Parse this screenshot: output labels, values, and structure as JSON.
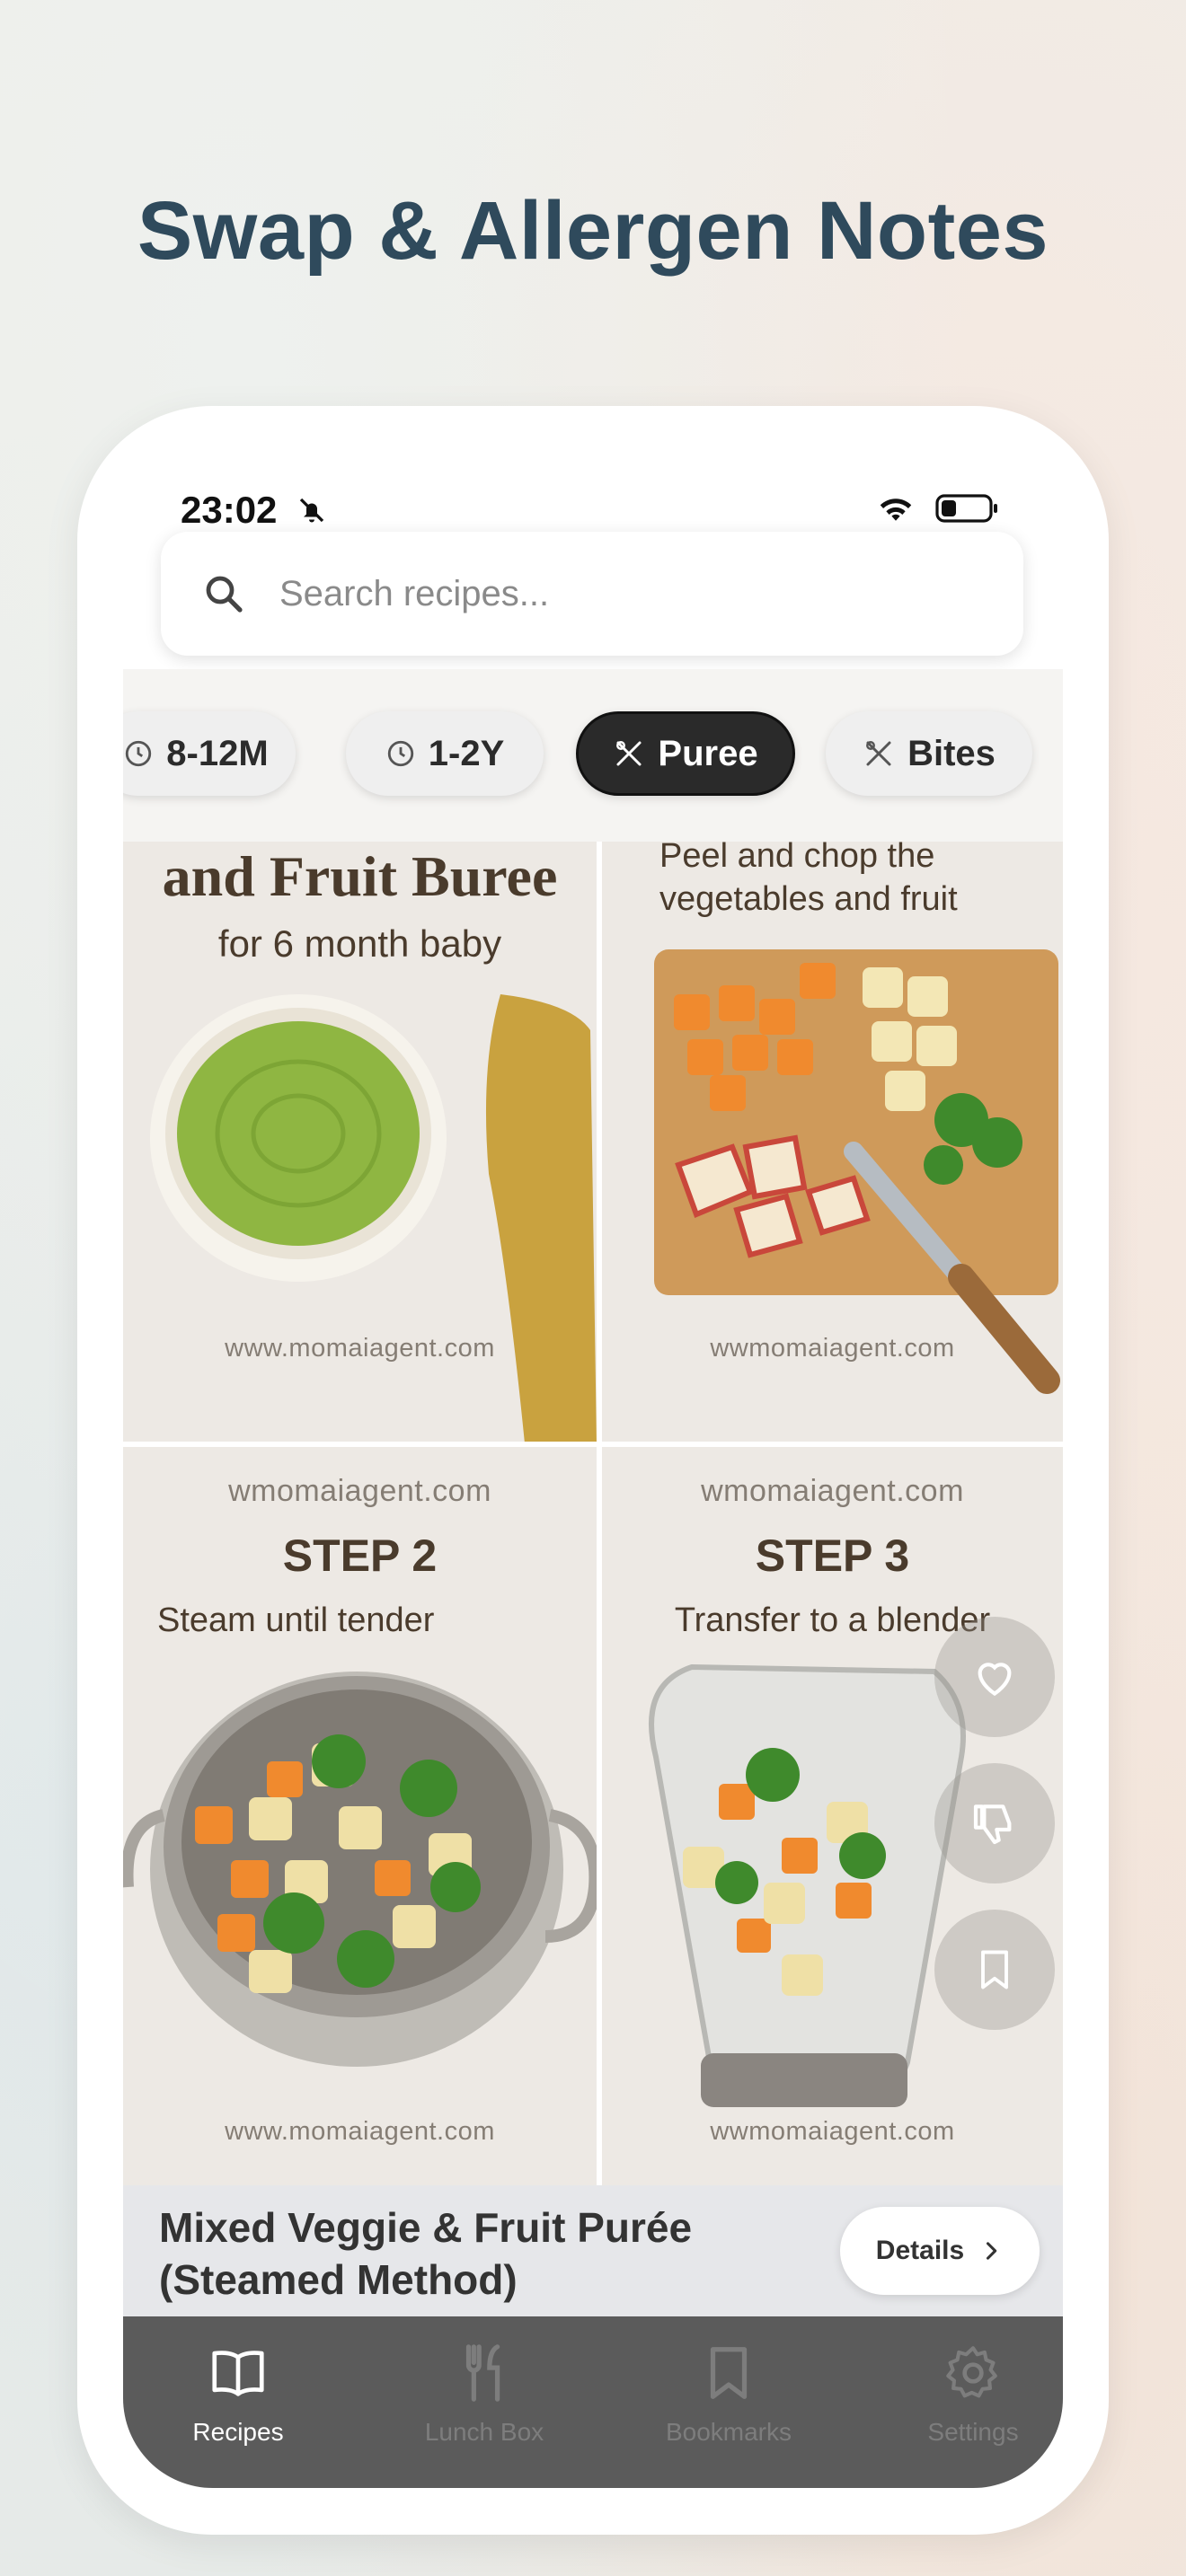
{
  "headline": "Swap & Allergen Notes",
  "status": {
    "time": "23:02"
  },
  "search": {
    "placeholder": "Search recipes..."
  },
  "filters": [
    {
      "label": "8-12M",
      "icon": "clock-icon",
      "active": false
    },
    {
      "label": "1-2Y",
      "icon": "clock-icon",
      "active": false
    },
    {
      "label": "Puree",
      "icon": "utensils-icon",
      "active": true
    },
    {
      "label": "Bites",
      "icon": "utensils-icon",
      "active": false
    }
  ],
  "cards": {
    "c1": {
      "title": "and Fruit Buree",
      "subtitle": "for 6 month baby",
      "watermark": "www.momaiagent.com"
    },
    "c2": {
      "title": "Peel and chop the vegetables and fruit",
      "watermark": "wwmomaiagent.com"
    },
    "c3": {
      "top_watermark": "wmomaiagent.com",
      "step": "STEP 2",
      "caption": "Steam until tender",
      "watermark": "www.momaiagent.com"
    },
    "c4": {
      "top_watermark": "wmomaiagent.com",
      "step": "STEP 3",
      "caption": "Transfer to a blender",
      "watermark": "wwmomaiagent.com"
    }
  },
  "recipe": {
    "title_line1": "Mixed Veggie & Fruit Purée",
    "title_line2": "(Steamed Method)",
    "details_label": "Details"
  },
  "tabs": [
    {
      "label": "Recipes",
      "icon": "book-icon",
      "active": true
    },
    {
      "label": "Lunch Box",
      "icon": "fork-knife-icon",
      "active": false
    },
    {
      "label": "Bookmarks",
      "icon": "bookmark-icon",
      "active": false
    },
    {
      "label": "Settings",
      "icon": "gear-icon",
      "active": false
    }
  ]
}
